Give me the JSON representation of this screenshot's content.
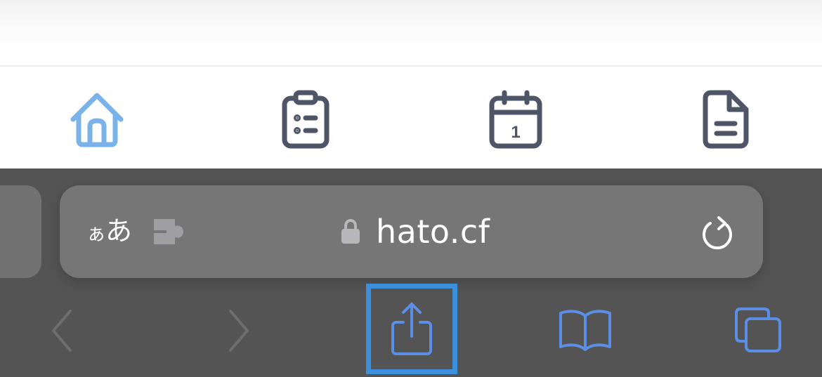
{
  "tab_bar": {
    "items": [
      {
        "icon": "home-icon",
        "active": true,
        "color": "#7ab3ea"
      },
      {
        "icon": "clipboard-list-icon",
        "active": false,
        "color": "#4d5566"
      },
      {
        "icon": "calendar-icon",
        "active": false,
        "color": "#4d5566",
        "date_label": "1"
      },
      {
        "icon": "document-icon",
        "active": false,
        "color": "#4d5566"
      }
    ]
  },
  "browser": {
    "address_bar": {
      "reader_label_small": "ぁ",
      "reader_label_large": "あ",
      "extension_icon": "puzzle-icon",
      "lock_icon": "lock-icon",
      "url": "hato.cf",
      "reload_icon": "reload-icon"
    },
    "toolbar": {
      "back_icon": "chevron-left-icon",
      "forward_icon": "chevron-right-icon",
      "share_icon": "share-icon",
      "bookmarks_icon": "book-icon",
      "tabs_icon": "tabs-icon",
      "accent_color": "#5b8fe6",
      "disabled_color": "#6e6e6e",
      "highlight_color": "#3b8fdb"
    }
  }
}
